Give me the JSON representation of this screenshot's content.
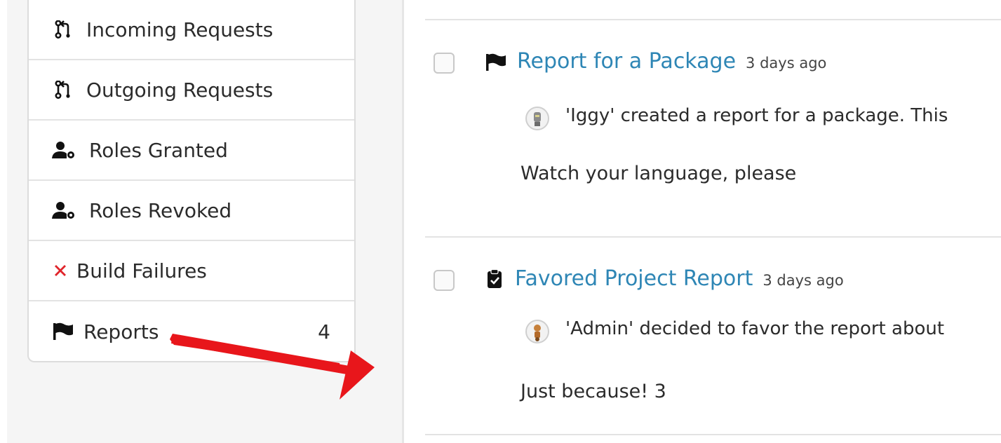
{
  "sidebar": {
    "items": [
      {
        "label": "Incoming Requests",
        "icon": "pull-request-icon"
      },
      {
        "label": "Outgoing Requests",
        "icon": "pull-request-icon"
      },
      {
        "label": "Roles Granted",
        "icon": "user-cog-icon"
      },
      {
        "label": "Roles Revoked",
        "icon": "user-cog-icon"
      },
      {
        "label": "Build Failures",
        "icon": "x-icon"
      },
      {
        "label": "Reports",
        "icon": "flag-icon",
        "count": "4"
      }
    ]
  },
  "notifications": [
    {
      "title": "Report for a Package",
      "time": "3 days ago",
      "icon": "flag-icon",
      "description": "'Iggy' created a report for a package. This",
      "comment": "Watch your language, please"
    },
    {
      "title": "Favored Project Report",
      "time": "3 days ago",
      "icon": "clipboard-check-icon",
      "description": "'Admin' decided to favor the report about",
      "comment": "Just because! 3"
    }
  ],
  "colors": {
    "link": "#2e86b5",
    "arrow": "#e8161b",
    "build_failure_icon": "#e0242a"
  }
}
